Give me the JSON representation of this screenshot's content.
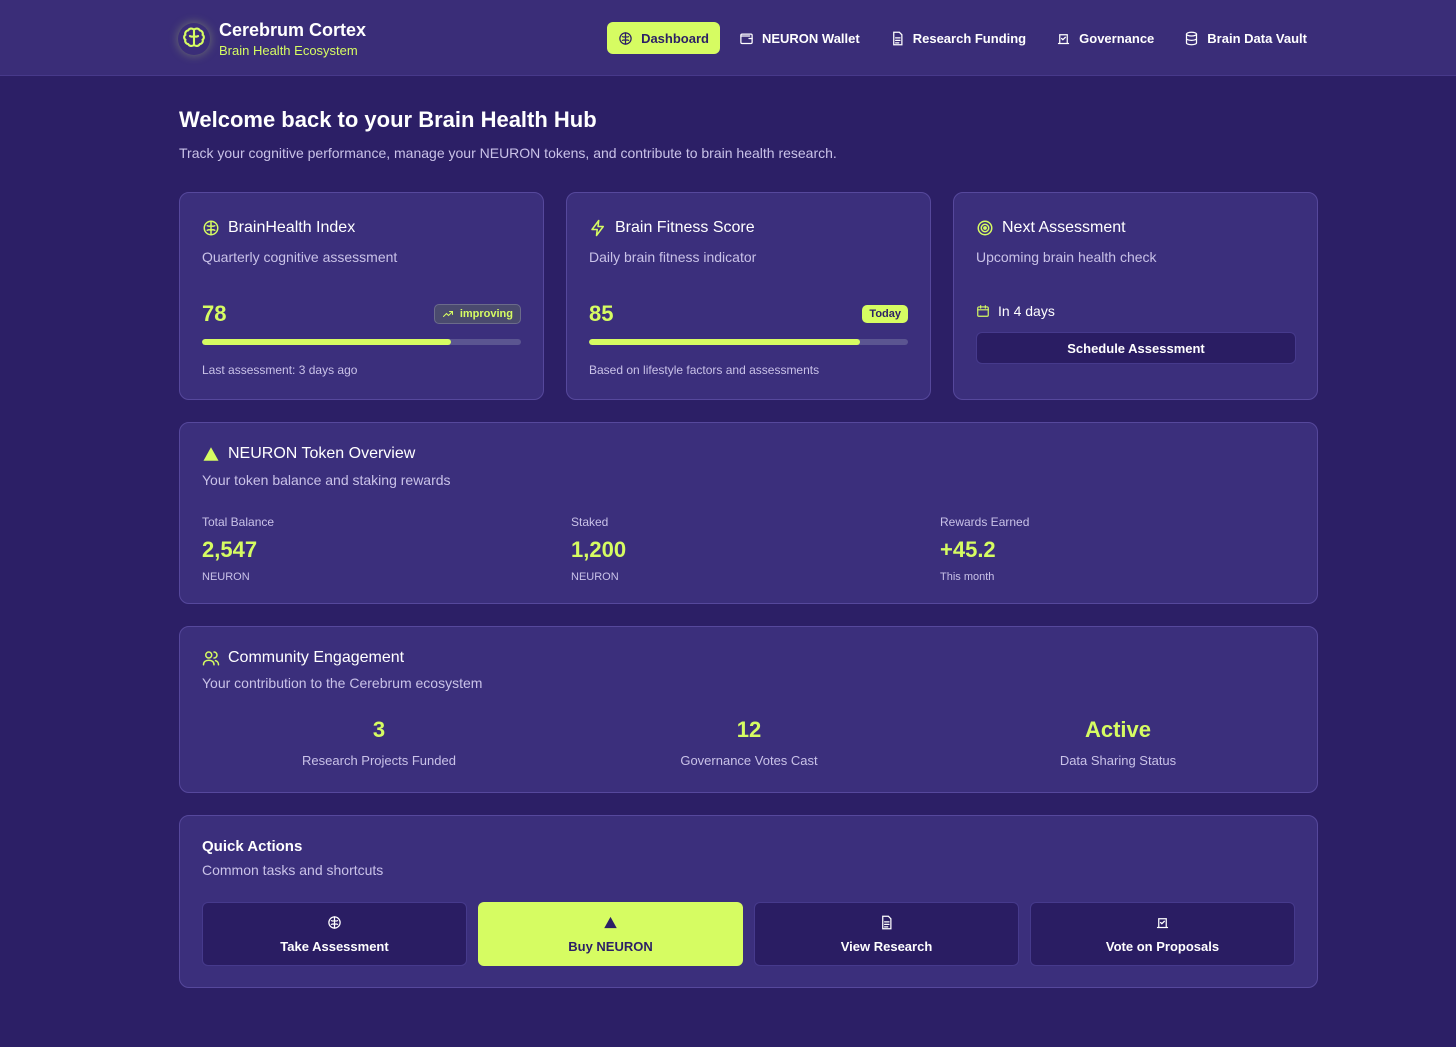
{
  "brand": {
    "title": "Cerebrum Cortex",
    "subtitle": "Brain Health Ecosystem",
    "icon": "brain-icon"
  },
  "nav": {
    "items": [
      {
        "label": "Dashboard",
        "icon": "brain-icon",
        "active": true
      },
      {
        "label": "NEURON Wallet",
        "icon": "wallet-icon",
        "active": false
      },
      {
        "label": "Research Funding",
        "icon": "document-icon",
        "active": false
      },
      {
        "label": "Governance",
        "icon": "vote-icon",
        "active": false
      },
      {
        "label": "Brain Data Vault",
        "icon": "database-icon",
        "active": false
      }
    ]
  },
  "welcome": {
    "title": "Welcome back to your Brain Health Hub",
    "subtitle": "Track your cognitive performance, manage your NEURON tokens, and contribute to brain health research."
  },
  "brainhealth": {
    "title": "BrainHealth Index",
    "subtitle": "Quarterly cognitive assessment",
    "score": "78",
    "badge": "improving",
    "progress_pct": 78,
    "footer": "Last assessment: 3 days ago"
  },
  "fitness": {
    "title": "Brain Fitness Score",
    "subtitle": "Daily brain fitness indicator",
    "score": "85",
    "badge": "Today",
    "progress_pct": 85,
    "footer": "Based on lifestyle factors and assessments"
  },
  "next_assessment": {
    "title": "Next Assessment",
    "subtitle": "Upcoming brain health check",
    "when": "In 4 days",
    "button": "Schedule Assessment"
  },
  "token": {
    "title": "NEURON Token Overview",
    "subtitle": "Your token balance and staking rewards",
    "columns": [
      {
        "label": "Total Balance",
        "value": "2,547",
        "unit": "NEURON"
      },
      {
        "label": "Staked",
        "value": "1,200",
        "unit": "NEURON"
      },
      {
        "label": "Rewards Earned",
        "value": "+45.2",
        "unit": "This month"
      }
    ]
  },
  "community": {
    "title": "Community Engagement",
    "subtitle": "Your contribution to the Cerebrum ecosystem",
    "stats": [
      {
        "value": "3",
        "label": "Research Projects Funded"
      },
      {
        "value": "12",
        "label": "Governance Votes Cast"
      },
      {
        "value": "Active",
        "label": "Data Sharing Status"
      }
    ]
  },
  "quick_actions": {
    "title": "Quick Actions",
    "subtitle": "Common tasks and shortcuts",
    "buttons": [
      {
        "label": "Take Assessment",
        "icon": "brain-icon"
      },
      {
        "label": "Buy NEURON",
        "icon": "triangle-icon"
      },
      {
        "label": "View Research",
        "icon": "document-icon"
      },
      {
        "label": "Vote on Proposals",
        "icon": "vote-icon"
      }
    ]
  },
  "colors": {
    "background": "#2c1f66",
    "card": "#3b2f7c",
    "accent": "#d6fc62"
  }
}
